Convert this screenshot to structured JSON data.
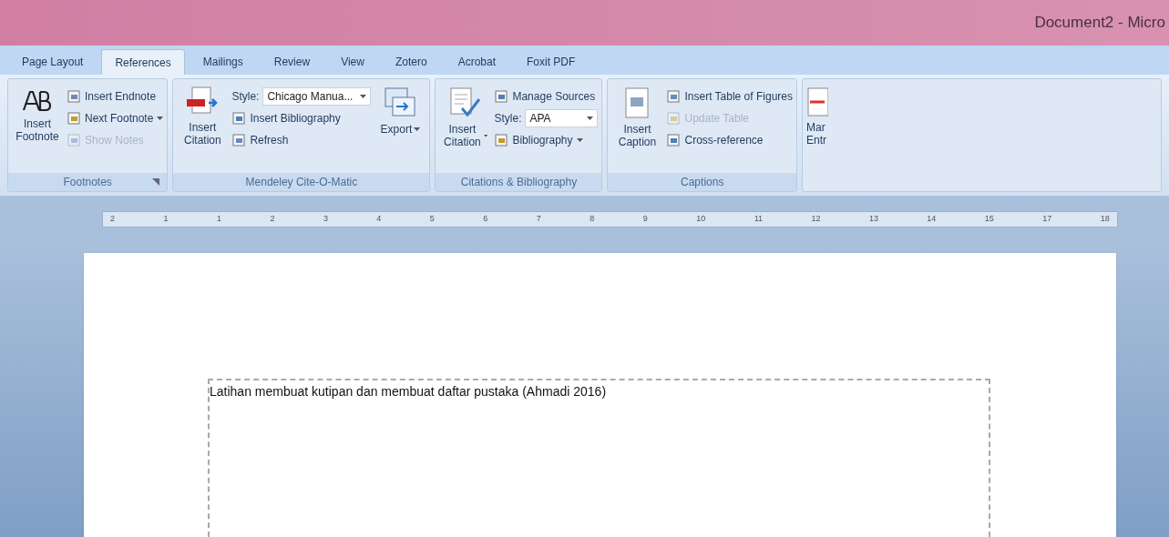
{
  "window": {
    "title": "Document2 - Micro"
  },
  "tabs": [
    {
      "label": "Page Layout",
      "selected": false
    },
    {
      "label": "References",
      "selected": true
    },
    {
      "label": "Mailings",
      "selected": false
    },
    {
      "label": "Review",
      "selected": false
    },
    {
      "label": "View",
      "selected": false
    },
    {
      "label": "Zotero",
      "selected": false
    },
    {
      "label": "Acrobat",
      "selected": false
    },
    {
      "label": "Foxit PDF",
      "selected": false
    }
  ],
  "groups": [
    {
      "name": "Footnotes",
      "launcher": true,
      "big": {
        "label": "Insert Footnote",
        "dropdown": false
      },
      "small": [
        {
          "kind": "button",
          "label": "Insert Endnote",
          "disabled": false,
          "dropdown": false
        },
        {
          "kind": "button",
          "label": "Next Footnote",
          "disabled": false,
          "dropdown": true
        },
        {
          "kind": "button",
          "label": "Show Notes",
          "disabled": true,
          "dropdown": false
        }
      ]
    },
    {
      "name": "Mendeley Cite-O-Matic",
      "launcher": false,
      "big": {
        "label": "Insert Citation",
        "dropdown": false
      },
      "small": [
        {
          "kind": "select",
          "label": "Style:",
          "value": "Chicago Manua..."
        },
        {
          "kind": "button",
          "label": "Insert Bibliography",
          "disabled": false,
          "dropdown": false
        },
        {
          "kind": "button",
          "label": "Refresh",
          "disabled": false,
          "dropdown": false
        }
      ],
      "trailing": {
        "label": "Export",
        "dropdown": true
      }
    },
    {
      "name": "Citations & Bibliography",
      "launcher": false,
      "big": {
        "label": "Insert Citation",
        "dropdown": true
      },
      "small": [
        {
          "kind": "button",
          "label": "Manage Sources",
          "disabled": false,
          "dropdown": false
        },
        {
          "kind": "select",
          "label": "Style:",
          "value": "APA"
        },
        {
          "kind": "button",
          "label": "Bibliography",
          "disabled": false,
          "dropdown": true
        }
      ]
    },
    {
      "name": "Captions",
      "launcher": false,
      "big": {
        "label": "Insert Caption",
        "dropdown": false
      },
      "small": [
        {
          "kind": "button",
          "label": "Insert Table of Figures",
          "disabled": false,
          "dropdown": false
        },
        {
          "kind": "button",
          "label": "Update Table",
          "disabled": true,
          "dropdown": false
        },
        {
          "kind": "button",
          "label": "Cross-reference",
          "disabled": false,
          "dropdown": false
        }
      ]
    }
  ],
  "partial_button": {
    "label": "Mar Entr"
  },
  "ruler": {
    "labels": [
      "2",
      "1",
      "1",
      "2",
      "3",
      "4",
      "5",
      "6",
      "7",
      "8",
      "9",
      "10",
      "11",
      "12",
      "13",
      "14",
      "15",
      "17",
      "18"
    ]
  },
  "document": {
    "text": "Latihan membuat kutipan dan membuat daftar pustaka (Ahmadi 2016)"
  }
}
